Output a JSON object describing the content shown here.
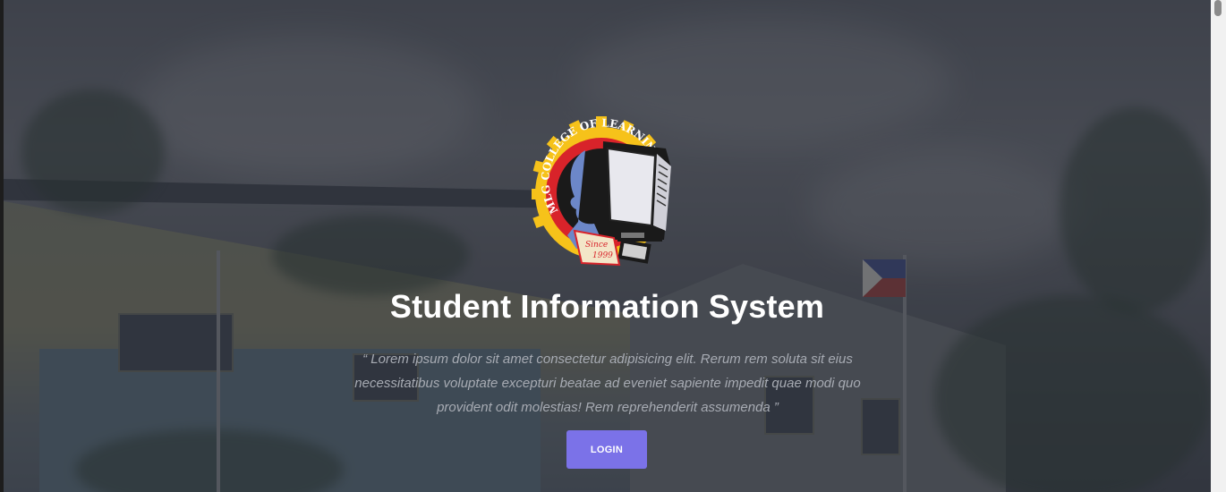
{
  "logo": {
    "name": "MLG College of Learning",
    "ring_text": "MLG COLLEGE OF LEARNING",
    "since_text": "Since",
    "year_text": "1999",
    "colors": {
      "gear": "#f6c21a",
      "ring": "#1a1a1a",
      "accent_red": "#d8232a",
      "face": "#6c87c8"
    }
  },
  "hero": {
    "title": "Student Information System",
    "quote": "“ Lorem ipsum dolor sit amet consectetur adipisicing elit. Rerum rem soluta sit eius necessitatibus voluptate excepturi beatae ad eveniet sapiente impedit quae modi quo provident odit molestias! Rem reprehenderit assumenda ”",
    "login_label": "LOGIN"
  },
  "colors": {
    "button": "#7b72e8",
    "title": "#ffffff",
    "quote": "#a7abb3",
    "overlay": "#2a2c34"
  }
}
